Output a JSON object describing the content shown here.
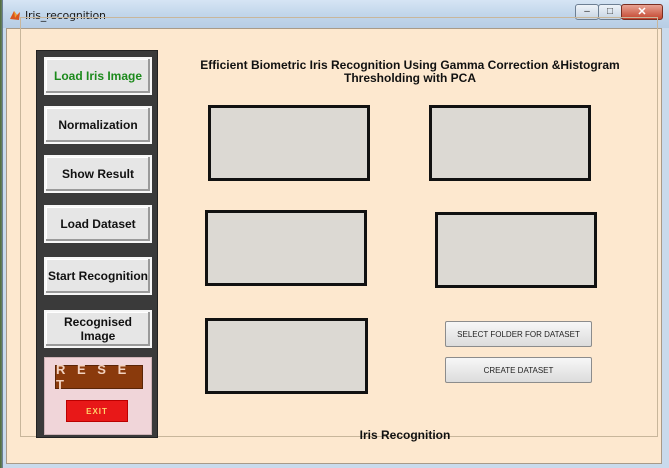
{
  "window": {
    "title": "Iris_recognition",
    "controls": {
      "minimize": "–",
      "maximize": "□",
      "close": "✕"
    }
  },
  "sidebar": {
    "buttons": [
      {
        "label": "Load Iris Image",
        "active": true
      },
      {
        "label": "Normalization",
        "active": false
      },
      {
        "label": "Show Result",
        "active": false
      },
      {
        "label": "Load Dataset",
        "active": false
      },
      {
        "label": "Start Recognition",
        "active": false
      },
      {
        "label": "Recognised Image",
        "active": false
      }
    ],
    "reset_label": "R E S E T",
    "exit_label": "EXIT"
  },
  "main": {
    "title_line1": "Efficient Biometric Iris Recognition Using Gamma Correction &Histogram",
    "title_line2": "Thresholding with PCA",
    "select_folder_label": "SELECT FOLDER FOR DATASET",
    "create_dataset_label": "CREATE DATASET",
    "footer_label": "Iris Recognition"
  },
  "colors": {
    "background": "#fde8cf",
    "sidebar": "#3a3a3a",
    "active_text": "#1c8a1c",
    "reset": "#8a3a0c",
    "exit": "#e81818"
  }
}
